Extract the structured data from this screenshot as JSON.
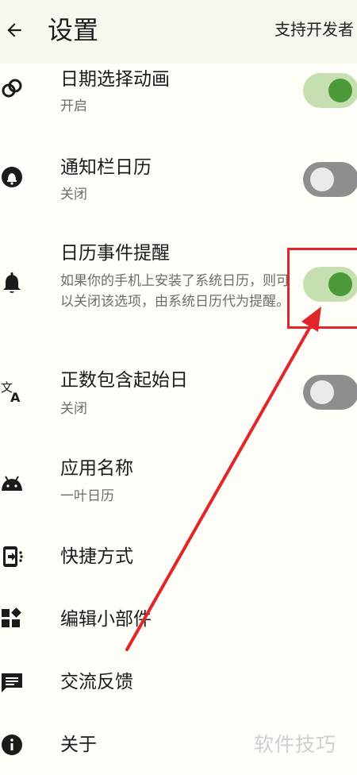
{
  "header": {
    "title": "设置",
    "action_label": "支持开发者"
  },
  "settings": [
    {
      "icon": "rings-icon",
      "title": "日期选择动画",
      "subtitle": "开启",
      "toggle": true
    },
    {
      "icon": "bell-filled-icon",
      "title": "通知栏日历",
      "subtitle": "关闭",
      "toggle": false
    },
    {
      "icon": "bell-icon",
      "title": "日历事件提醒",
      "subtitle": "如果你的手机上安装了系统日历，则可以关闭该选项，由系统日历代为提醒。",
      "toggle": true
    },
    {
      "icon": "translate-icon",
      "title": "正数包含起始日",
      "subtitle": "关闭",
      "toggle": false
    },
    {
      "icon": "android-icon",
      "title": "应用名称",
      "subtitle": "一叶日历"
    },
    {
      "icon": "shortcut-icon",
      "title": "快捷方式"
    },
    {
      "icon": "widgets-icon",
      "title": "编辑小部件"
    },
    {
      "icon": "feedback-icon",
      "title": "交流反馈"
    },
    {
      "icon": "info-icon",
      "title": "关于"
    }
  ],
  "watermark": "软件技巧",
  "colors": {
    "accent": "#4b9a37",
    "accent_track": "#c6dfb0",
    "annotation": "#e0262b"
  }
}
